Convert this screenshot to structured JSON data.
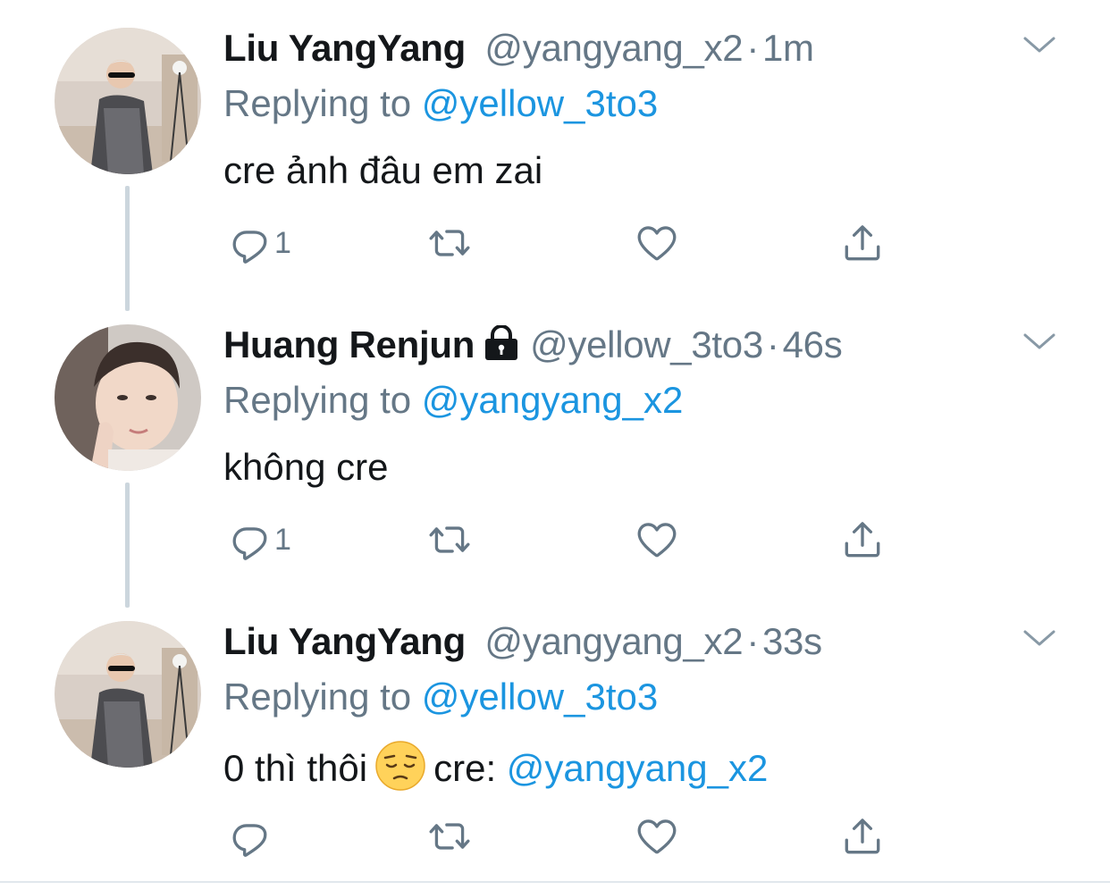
{
  "colors": {
    "link": "#1b95e0",
    "muted": "#657786",
    "text": "#14171a",
    "thread_line": "#ccd6dd"
  },
  "tweets": [
    {
      "name": "Liu YangYang",
      "handle": "@yangyang_x2",
      "separator": "·",
      "time": "1m",
      "replying_prefix": "Replying to",
      "replying_to": "@yellow_3to3",
      "text": "cre ảnh đâu em zai",
      "reply_count": "1",
      "verified_lock": false,
      "avatar": "avatar-liu-yangyang"
    },
    {
      "name": "Huang Renjun",
      "handle": "@yellow_3to3",
      "separator": "·",
      "time": "46s",
      "replying_prefix": "Replying to",
      "replying_to": "@yangyang_x2",
      "text": "không cre",
      "reply_count": "1",
      "verified_lock": true,
      "avatar": "avatar-huang-renjun"
    },
    {
      "name": "Liu YangYang",
      "handle": "@yangyang_x2",
      "separator": "·",
      "time": "33s",
      "replying_prefix": "Replying to",
      "replying_to": "@yellow_3to3",
      "text_before": "0 thì thôi",
      "emoji": "pensive-face",
      "text_after": "cre:",
      "text_mention": "@yangyang_x2",
      "reply_count": "",
      "avatar": "avatar-liu-yangyang"
    }
  ],
  "icons": {
    "reply": "reply-icon",
    "retweet": "retweet-icon",
    "like": "heart-icon",
    "share": "share-icon",
    "caret": "chevron-down-icon",
    "lock": "lock-icon"
  }
}
